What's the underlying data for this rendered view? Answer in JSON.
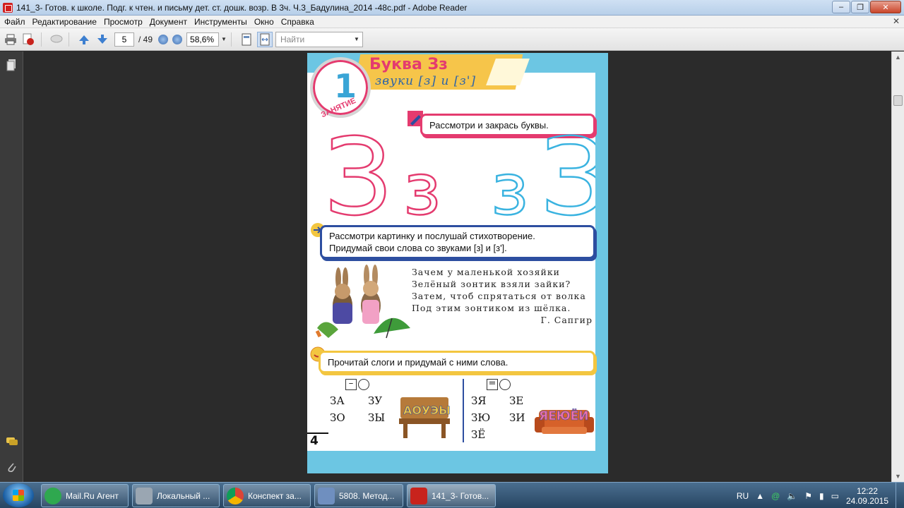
{
  "window": {
    "title": "141_3- Готов. к школе. Подг. к чтен. и письму дет. ст. дошк. возр. В 3ч. Ч.3_Бадулина_2014 -48с.pdf - Adobe Reader",
    "minimize": "–",
    "maximize": "❐",
    "close": "✕"
  },
  "menu": {
    "items": [
      "Файл",
      "Редактирование",
      "Просмотр",
      "Документ",
      "Инструменты",
      "Окно",
      "Справка"
    ],
    "close": "✕"
  },
  "toolbar": {
    "page_current": "5",
    "page_total": "/ 49",
    "zoom": "58,6%",
    "find_placeholder": "Найти"
  },
  "document": {
    "letter_title": "Буква Зз",
    "sound_subtitle": "звуки [з] и [з']",
    "lesson_number": "1",
    "lesson_label": "ЗАНЯТИЕ",
    "task1": "Рассмотри и закрась буквы.",
    "big_letters": [
      "З",
      "з",
      "з",
      "З"
    ],
    "task2_line1": "Рассмотри картинку и послушай стихотворение.",
    "task2_line2": "Придумай свои слова со звуками [з] и [з'].",
    "poem": [
      "Зачем у маленькой хозяйки",
      "Зелёный зонтик взяли зайки?",
      "Затем, чтоб спрятаться от волка",
      "Под этим зонтиком из шёлка."
    ],
    "poem_author": "Г. Сапгир",
    "task3": "Прочитай слоги и придумай с ними слова.",
    "syllables_left": [
      "ЗА",
      "ЗУ",
      "ЗО",
      "ЗЫ"
    ],
    "syllables_right": [
      "ЗЯ",
      "ЗЕ",
      "ЗЮ",
      "ЗИ",
      "ЗЁ"
    ],
    "schema_left_mark": "–",
    "schema_right_mark": "=",
    "page_number": "4",
    "bench_letters": "АОУЭЫ",
    "sofa_letters": "ЯЕЮЁИ"
  },
  "taskbar": {
    "buttons": [
      {
        "label": "Mail.Ru Агент",
        "color": "#2fa84f"
      },
      {
        "label": "Локальный ...",
        "color": "#9aa6b2"
      },
      {
        "label": "Конспект за...",
        "color": "#e0a020"
      },
      {
        "label": "5808. Метод...",
        "color": "#6f8fbf"
      },
      {
        "label": "141_3- Готов...",
        "color": "#c8231d"
      }
    ],
    "lang": "RU",
    "time": "12:22",
    "date": "24.09.2015"
  },
  "colors": {
    "pink": "#e43b6f",
    "blue": "#3ab3e0",
    "navy": "#2d4ea0",
    "yellow": "#f3c640"
  }
}
